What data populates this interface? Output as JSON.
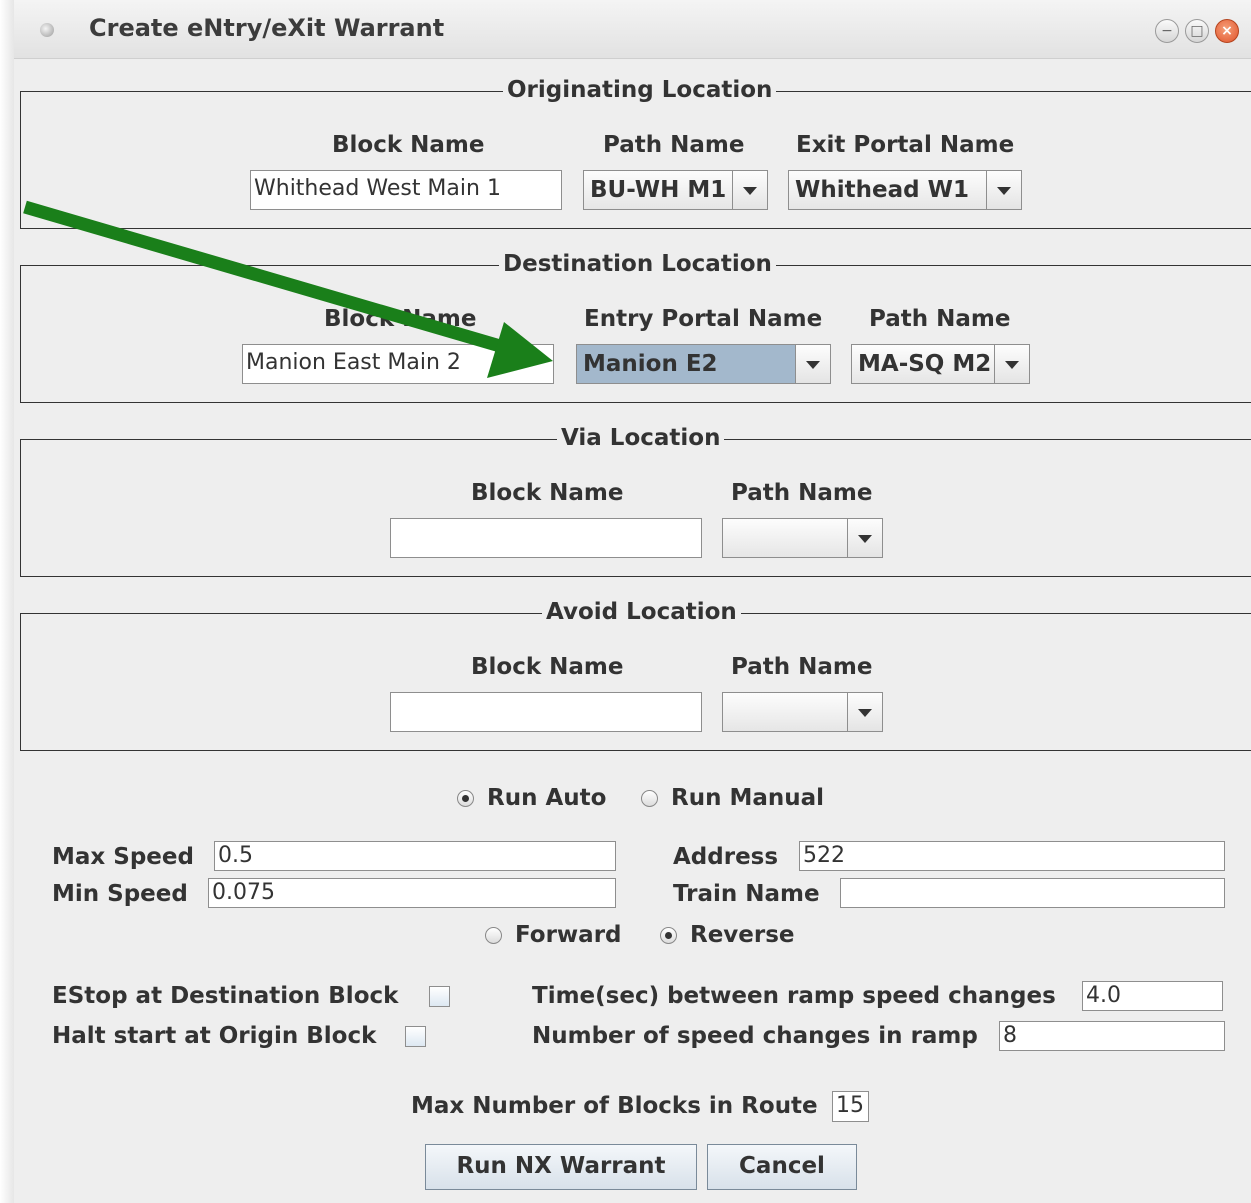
{
  "window": {
    "title": "Create eNtry/eXit Warrant",
    "controls": {
      "minimize": "−",
      "maximize": "□",
      "close": "×"
    }
  },
  "originating": {
    "title": "Originating Location",
    "block_label": "Block Name",
    "path_label": "Path Name",
    "portal_label": "Exit Portal Name",
    "block_value": "Whithead West Main 1",
    "path_value": "BU-WH M1",
    "portal_value": "Whithead W1"
  },
  "destination": {
    "title": "Destination Location",
    "block_label": "Block Name",
    "portal_label": "Entry Portal Name",
    "path_label": "Path Name",
    "block_value": "Manion East Main 2",
    "portal_value": "Manion E2",
    "path_value": "MA-SQ M2"
  },
  "via": {
    "title": "Via Location",
    "block_label": "Block Name",
    "path_label": "Path Name",
    "block_value": "",
    "path_value": ""
  },
  "avoid": {
    "title": "Avoid Location",
    "block_label": "Block Name",
    "path_label": "Path Name",
    "block_value": "",
    "path_value": ""
  },
  "run_mode": {
    "auto_label": "Run Auto",
    "manual_label": "Run Manual",
    "selected": "auto"
  },
  "speed": {
    "max_label": "Max Speed",
    "max_value": "0.5",
    "min_label": "Min Speed",
    "min_value": "0.075",
    "address_label": "Address",
    "address_value": "522",
    "train_label": "Train Name",
    "train_value": ""
  },
  "direction": {
    "forward_label": "Forward",
    "reverse_label": "Reverse",
    "selected": "reverse"
  },
  "options": {
    "estop_label": "EStop at Destination Block",
    "estop_checked": false,
    "halt_label": "Halt start at Origin Block",
    "halt_checked": false,
    "ramp_time_label": "Time(sec) between ramp speed changes",
    "ramp_time_value": "4.0",
    "ramp_steps_label": "Number of speed changes in ramp",
    "ramp_steps_value": "8"
  },
  "max_blocks": {
    "label": "Max Number of Blocks in Route",
    "value": "15"
  },
  "buttons": {
    "run_label": "Run NX Warrant",
    "cancel_label": "Cancel"
  },
  "colors": {
    "annotation_arrow": "#1a7f1a",
    "selected_combo": "#a3b8cc",
    "window_bg": "#eeeeee"
  }
}
